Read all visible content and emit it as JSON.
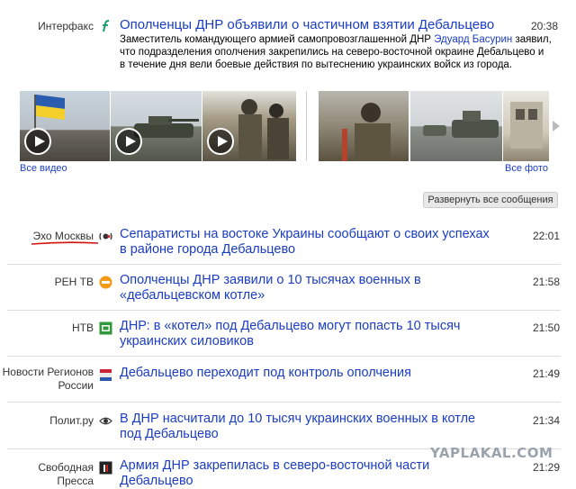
{
  "lead": {
    "source": "Интерфакс",
    "title": "Ополченцы ДНР объявили о частичном взятии Дебальцево",
    "time": "20:38",
    "snippet_before": "Заместитель командующего армией самопровозглашенной ДНР ",
    "snippet_link": "Эдуард Басурин",
    "snippet_after": " заявил, что подразделения ополчения закрепились на северо-восточной окраине Дебальцево и в течение дня вели боевые действия по вытеснению украинских войск из города."
  },
  "media": {
    "all_video": "Все видео",
    "all_photo": "Все фото"
  },
  "expand_button": "Развернуть все сообщения",
  "items": [
    {
      "source": "Эхо Москвы",
      "title": "Сепаратисты на востоке Украины сообщают о своих успехах в районе города Дебальцево",
      "time": "22:01",
      "icon": "echo-icon"
    },
    {
      "source": "РЕН ТВ",
      "title": "Ополченцы ДНР заявили о 10 тысячах военных в «дебальцевском котле»",
      "time": "21:58",
      "icon": "ren-tv-icon"
    },
    {
      "source": "НТВ",
      "title": "ДНР: в «котел» под Дебальцево могут попасть 10 тысяч украинских силовиков",
      "time": "21:50",
      "icon": "ntv-icon"
    },
    {
      "source": "Новости Регионов России",
      "title": "Дебальцево переходит под контроль ополчения",
      "time": "21:49",
      "icon": "regions-icon"
    },
    {
      "source": "Полит.ру",
      "title": "В ДНР насчитали до 10 тысяч украинских военных в котле под Дебальцево",
      "time": "21:34",
      "icon": "polit-eye-icon"
    },
    {
      "source": "Свободная Пресса",
      "title": "Армия ДНР закрепилась в северо-восточной части Дебальцево",
      "time": "21:29",
      "icon": "sp-icon"
    }
  ],
  "watermark": "YAPLAKAL.COM"
}
